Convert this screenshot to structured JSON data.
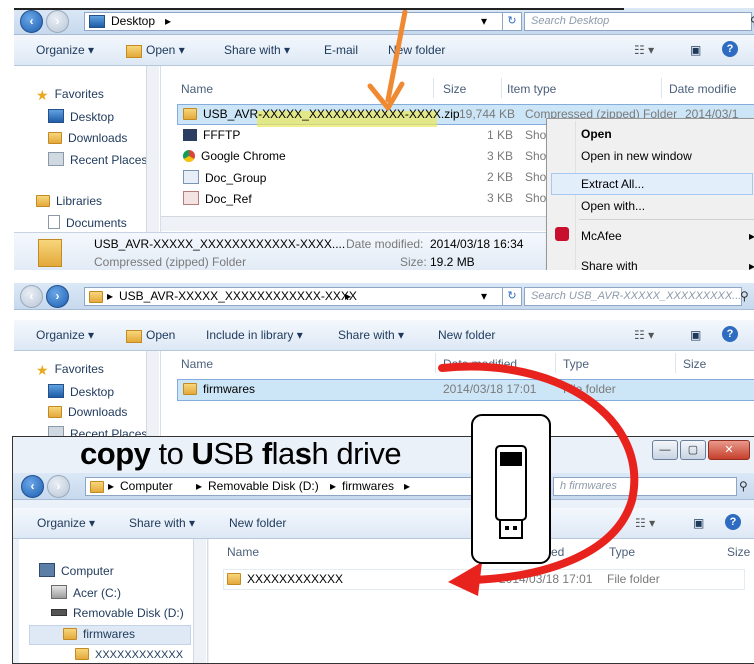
{
  "panel1": {
    "location": "Desktop",
    "search_placeholder": "Search Desktop",
    "toolbar": [
      "Organize ▾",
      "Open ▾",
      "Share with ▾",
      "E-mail",
      "New folder"
    ],
    "sidebar": {
      "favorites_label": "Favorites",
      "items": [
        "Desktop",
        "Downloads",
        "Recent Places"
      ],
      "libraries_label": "Libraries",
      "lib_items": [
        "Documents"
      ]
    },
    "columns": [
      "Name",
      "Size",
      "Item type",
      "Date modifie"
    ],
    "rows": [
      {
        "name": "USB_AVR-XXXXX_XXXXXXXXXXXX-XXXX.zip",
        "size": "19,744 KB",
        "type": "Compressed (zipped) Folder",
        "date": "2014/03/1"
      },
      {
        "name": "FFFTP",
        "size": "1 KB",
        "type": "Sho"
      },
      {
        "name": "Google Chrome",
        "size": "3 KB",
        "type": "Sho"
      },
      {
        "name": "Doc_Group",
        "size": "2 KB",
        "type": "Sho"
      },
      {
        "name": "Doc_Ref",
        "size": "3 KB",
        "type": "Sho"
      }
    ],
    "context_menu": [
      "Open",
      "Open in new window",
      "Extract All...",
      "Open with...",
      "McAfee",
      "Share with"
    ],
    "details": {
      "name": "USB_AVR-XXXXX_XXXXXXXXXXXX-XXXX....",
      "date_label": "Date modified:",
      "date": "2014/03/18 16:34",
      "type": "Compressed (zipped) Folder",
      "size_label": "Size:",
      "size": "19.2 MB"
    }
  },
  "panel2": {
    "location": "USB_AVR-XXXXX_XXXXXXXXXXXX-XXXX",
    "search_placeholder": "Search USB_AVR-XXXXX_XXXXXXXXX...",
    "toolbar": [
      "Organize ▾",
      "Open",
      "Include in library ▾",
      "Share with ▾",
      "New folder"
    ],
    "sidebar": {
      "favorites_label": "Favorites",
      "items": [
        "Desktop",
        "Downloads",
        "Recent Places"
      ]
    },
    "columns": [
      "Name",
      "Date modified",
      "Type",
      "Size"
    ],
    "rows": [
      {
        "name": "firmwares",
        "date": "2014/03/18 17:01",
        "type": "File folder"
      }
    ]
  },
  "panel3": {
    "crumbs": [
      "Computer",
      "Removable Disk (D:)",
      "firmwares"
    ],
    "search_placeholder": "h firmwares",
    "toolbar": [
      "Organize ▾",
      "Share with ▾",
      "New folder"
    ],
    "sidebar": {
      "computer_label": "Computer",
      "items": [
        "Acer (C:)",
        "Removable Disk (D:)",
        "firmwares",
        "XXXXXXXXXXXX"
      ]
    },
    "columns": [
      "Name",
      "ed",
      "Type",
      "Size"
    ],
    "rows": [
      {
        "name": "XXXXXXXXXXXX",
        "date": "2014/03/18 17:01",
        "type": "File folder"
      }
    ]
  },
  "caption": {
    "c": "c",
    "o1": "o",
    "p": "p",
    "y": "y",
    "to": " to ",
    "U": "U",
    "SB": "SB ",
    "f": "f",
    "la": "la",
    "s": "s",
    "h": "h",
    "drive": " drive"
  },
  "window_controls": [
    "—",
    "▢",
    "✕"
  ],
  "colors": {
    "arrow_orange": "#f08a32",
    "arrow_red": "#e8231d",
    "selection": "#cde6f7"
  }
}
